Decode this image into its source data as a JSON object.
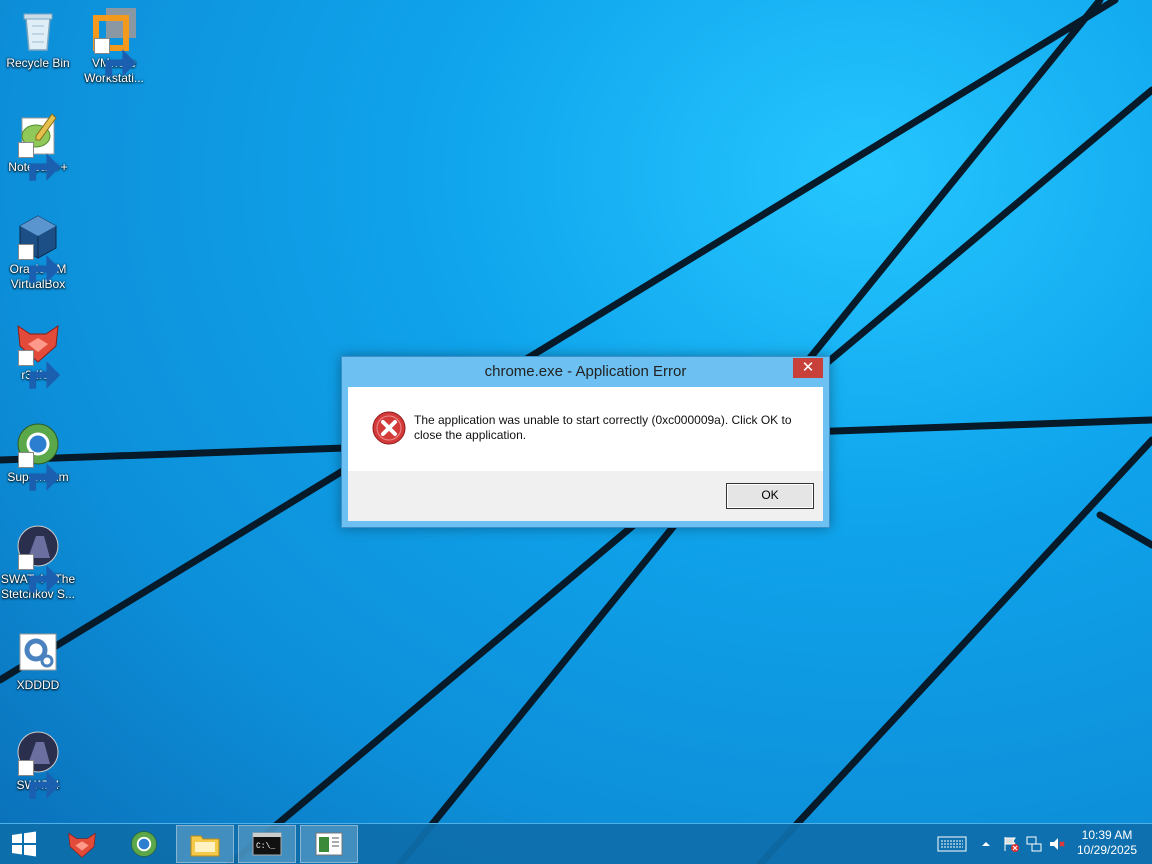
{
  "desktop": {
    "icons": [
      {
        "label": "Recycle Bin"
      },
      {
        "label": "VMware Workstati..."
      },
      {
        "label": "Notepad++"
      },
      {
        "label": "Oracle VM VirtualBox"
      },
      {
        "label": "r3dfox"
      },
      {
        "label": "Supermium"
      },
      {
        "label": "SWAT 4 - The Stetchkov S..."
      },
      {
        "label": "XDDDD"
      },
      {
        "label": "SWAT 4"
      }
    ]
  },
  "dialog": {
    "title": "chrome.exe - Application Error",
    "close_label": "✕",
    "message": "The application was unable to start correctly (0xc000009a). Click OK to close the application.",
    "ok_label": "OK",
    "icon": "error-icon"
  },
  "taskbar": {
    "start_icon": "windows-logo-icon",
    "pinned": [
      "r3dfox",
      "Supermium",
      "File Explorer",
      "Command Prompt",
      "Application window"
    ],
    "tray_icons": [
      "keyboard-icon",
      "chevron-up-icon",
      "flag-alert-icon",
      "network-icon",
      "volume-muted-icon"
    ]
  },
  "clock": {
    "time": "10:39 AM",
    "date": "10/29/2025"
  },
  "colors": {
    "wallpaper": "#0fa4ec",
    "dialog_frame": "#6cc0f2",
    "close_button": "#c7403a",
    "taskbar": "#0e6eaa"
  }
}
